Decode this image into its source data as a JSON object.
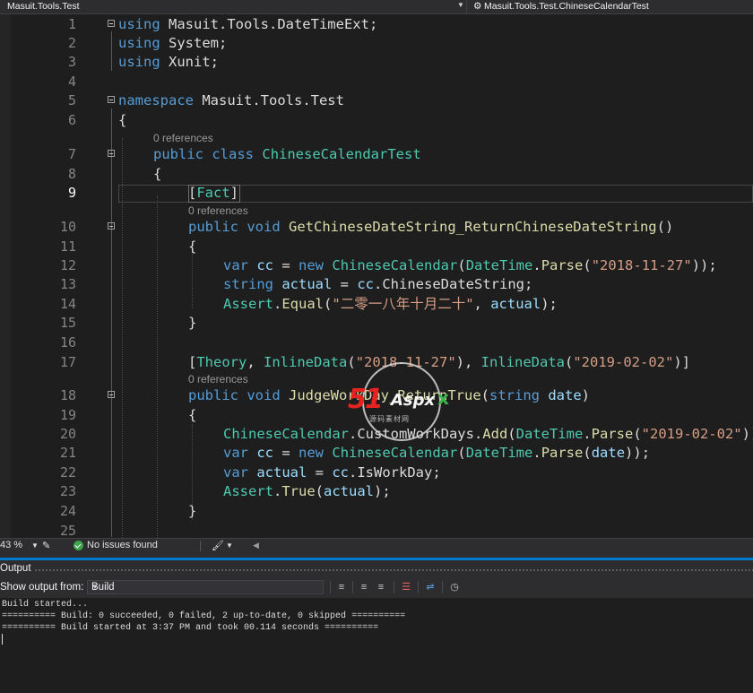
{
  "nav": {
    "left": "Masuit.Tools.Test",
    "right": "Masuit.Tools.Test.ChineseCalendarTest"
  },
  "editor": {
    "current_line": 9,
    "references_label": "0 references",
    "line_numbers": [
      "1",
      "2",
      "3",
      "4",
      "5",
      "6",
      "7",
      "8",
      "9",
      "10",
      "11",
      "12",
      "13",
      "14",
      "15",
      "16",
      "17",
      "18",
      "19",
      "20",
      "21",
      "22",
      "23",
      "24",
      "25"
    ]
  },
  "status": {
    "zoom": "43 %",
    "issues": "No issues found"
  },
  "output": {
    "title": "Output",
    "show_from_label": "Show output from:",
    "source": "Build",
    "lines": [
      "Build started...",
      "========== Build: 0 succeeded, 0 failed, 2 up-to-date, 0 skipped ==========",
      "========== Build started at 3:37 PM and took 00.114 seconds =========="
    ]
  },
  "watermark": {
    "number": "51",
    "brand": "Aspx",
    "tail": "x",
    "sub": "源码素材网"
  },
  "colors": {
    "keyword": "#569cd6",
    "type": "#4ec9b0",
    "method": "#dcdcaa",
    "string": "#d69d85",
    "variable": "#9cdcfe",
    "accent": "#007acc"
  }
}
